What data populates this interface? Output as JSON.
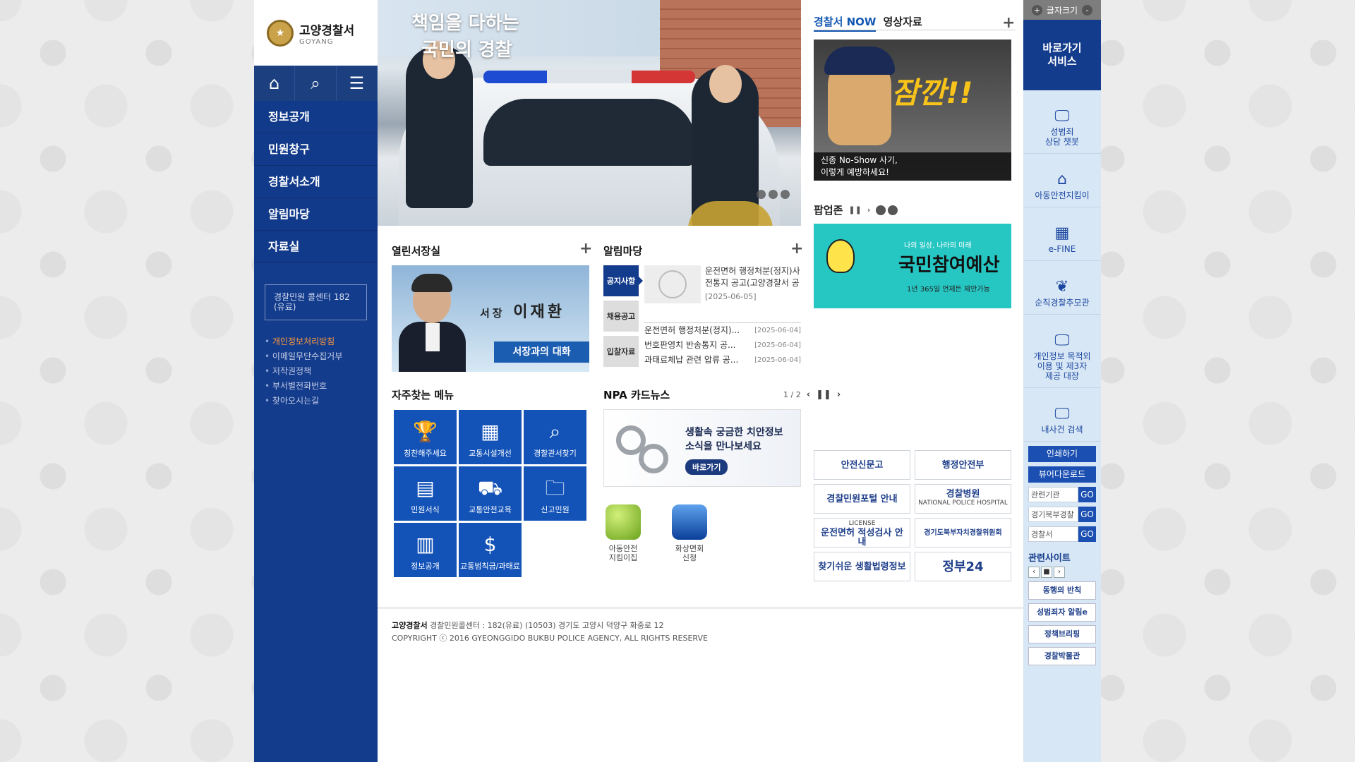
{
  "logo": {
    "name": "고양경찰서",
    "sub": "GOYANG"
  },
  "gnb": [
    "정보공개",
    "민원창구",
    "경찰서소개",
    "알림마당",
    "자료실"
  ],
  "callcenter": "경찰민원 콜센터 182 (유료)",
  "sidebar_links": [
    "개인정보처리방침",
    "이메일무단수집거부",
    "저작권정책",
    "부서별전화번호",
    "찾아오시는길"
  ],
  "banner": {
    "headline1": "책임을 다하는",
    "headline2": "국민의 경찰"
  },
  "chief": {
    "title": "서장과의 대화",
    "rank": "서장",
    "name": "이재환",
    "section": "열린서장실"
  },
  "notice": {
    "section": "알림마당",
    "tabs": [
      "공지사항",
      "채용공고",
      "입찰자료"
    ],
    "feature_text": "운전면허 행정처분(정지)사전통지 공고(고양경찰서 공",
    "feature_date": "[2025-06-05]",
    "items": [
      {
        "title": "운전면허 행정처분(정지)...",
        "date": "[2025-06-04]"
      },
      {
        "title": "번호판영치 반송통지 공...",
        "date": "[2025-06-04]"
      },
      {
        "title": "과태료체납 관련 압류 공...",
        "date": "[2025-06-04]"
      }
    ]
  },
  "freq": {
    "section": "자주찾는 메뉴",
    "page": "1 / 2",
    "items": [
      {
        "label": "칭찬해주세요",
        "icon": "trophy-icon"
      },
      {
        "label": "교통시설개선",
        "icon": "traffic-icon"
      },
      {
        "label": "경찰관서찾기",
        "icon": "search-icon"
      },
      {
        "label": "민원서식",
        "icon": "form-icon"
      },
      {
        "label": "교통안전교육",
        "icon": "car-icon"
      },
      {
        "label": "신고민원",
        "icon": "folder-icon"
      },
      {
        "label": "정보공개",
        "icon": "board-icon"
      },
      {
        "label": "교통범칙금/과태료",
        "icon": "money-icon"
      }
    ]
  },
  "cardnews": {
    "section": "NPA 카드뉴스",
    "line1": "생활속 궁금한 치안정보",
    "line2": "소식을 만나보세요",
    "go": "바로가기"
  },
  "apps": [
    {
      "line1": "아동안전",
      "line2": "지킴이집"
    },
    {
      "line1": "화상면회",
      "line2": "신청"
    }
  ],
  "right": {
    "tabs": [
      "경찰서 NOW",
      "영상자료"
    ],
    "now_big": "잠깐!!",
    "now_caption1": "신종 No-Show 사기,",
    "now_caption2": "이렇게 예방하세요!",
    "popup": "팝업존",
    "popup_big": "국민참여예산",
    "popup_sub": "1년 365일 언제든 제안가능",
    "popup_small": "나의 일상, 나라의 미래"
  },
  "banners": [
    {
      "title": "안전신문고",
      "sub": ""
    },
    {
      "title": "행정안전부",
      "sub": ""
    },
    {
      "title": "경찰민원포털 안내",
      "sub": ""
    },
    {
      "title": "경찰병원",
      "sub": "NATIONAL POLICE HOSPITAL"
    },
    {
      "title": "운전면허 적성검사 안내",
      "sub": "LICENSE"
    },
    {
      "title": "경기도북부자치경찰위원회",
      "sub": ""
    },
    {
      "title": "찾기쉬운 생활법령정보",
      "sub": ""
    },
    {
      "title": "정부24",
      "sub": ""
    }
  ],
  "qs": {
    "fontsize": "글자크기",
    "head1": "바로가기",
    "head2": "서비스",
    "items": [
      {
        "l1": "성범죄",
        "l2": "상담 챗봇",
        "l3": ""
      },
      {
        "l1": "아동안전지킴이",
        "l2": "",
        "l3": ""
      },
      {
        "l1": "e-FINE",
        "l2": "",
        "l3": ""
      },
      {
        "l1": "순직경찰추모관",
        "l2": "",
        "l3": ""
      },
      {
        "l1": "개인정보 목적외",
        "l2": "이용 및 제3자",
        "l3": "제공 대장"
      },
      {
        "l1": "내사건 검색",
        "l2": "",
        "l3": ""
      }
    ],
    "print": "인쇄하기",
    "viewer": "뷰어다운로드",
    "selects": [
      "관련기관",
      "경기북부경찰",
      "경찰서"
    ],
    "go": "GO",
    "related": "관련사이트",
    "related_banners": [
      "동행의 반칙",
      "성범죄자 알림e",
      "정책브리핑",
      "경찰박물관"
    ]
  },
  "footer": {
    "name": "고양경찰서",
    "line1": "경찰민원콜센터 : 182(유료) (10503) 경기도 고양시 덕양구 화중로 12",
    "line2": "COPYRIGHT ⓒ 2016 GYEONGGIDO BUKBU POLICE AGENCY, ALL RIGHTS RESERVE"
  }
}
